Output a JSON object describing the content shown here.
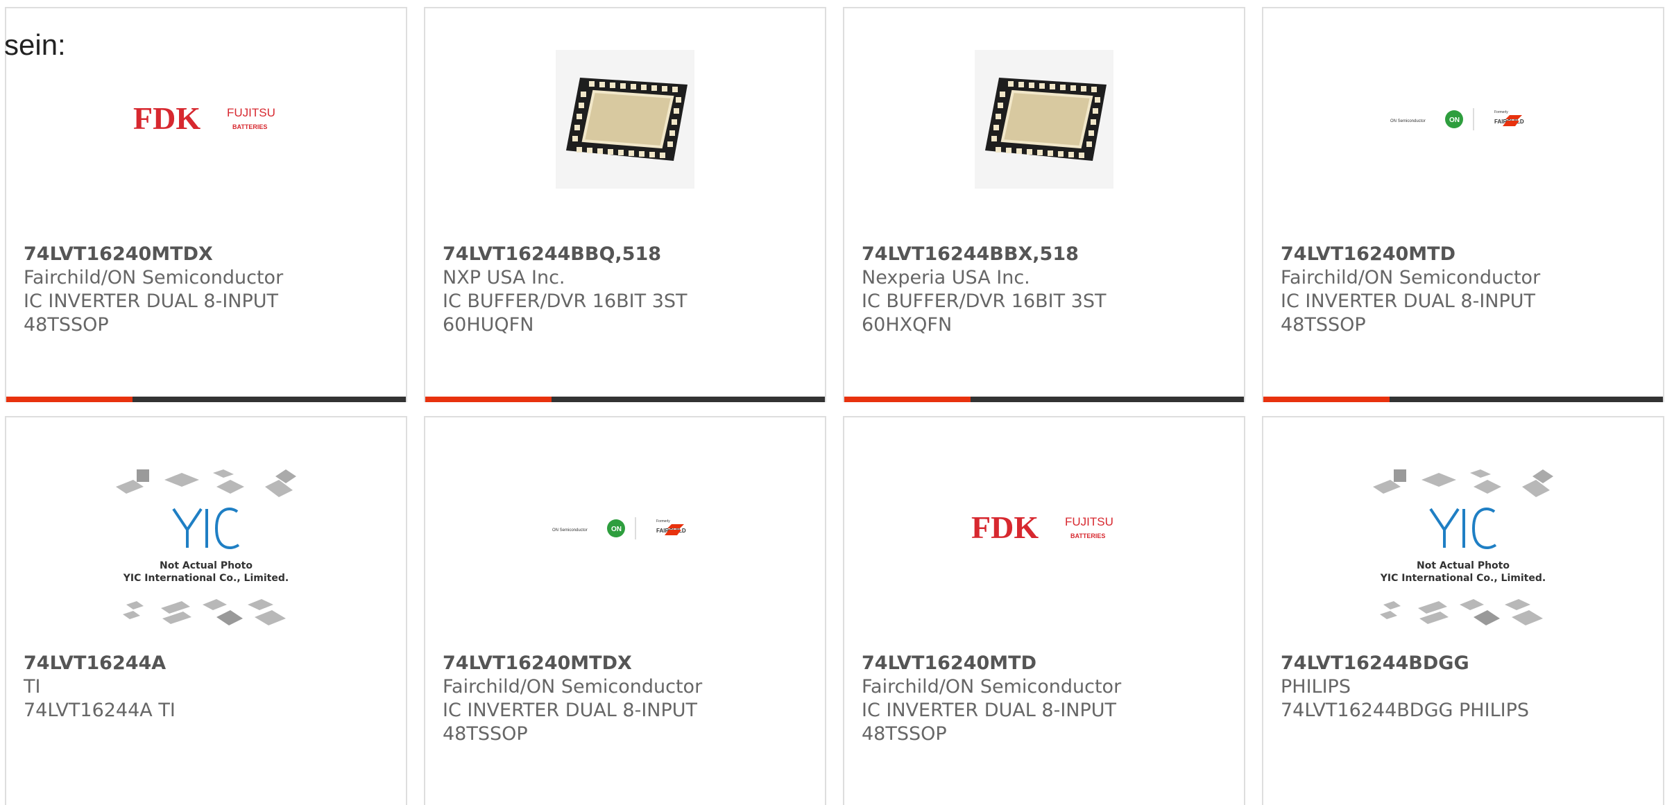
{
  "intro_text": "sein:",
  "products": [
    {
      "part": "74LVT16240MTDX",
      "manufacturer": "Fairchild/ON Semiconductor",
      "desc1": "IC INVERTER DUAL 8-INPUT",
      "desc2": "48TSSOP",
      "image": "fdk-fujitsu-logo"
    },
    {
      "part": "74LVT16244BBQ,518",
      "manufacturer": "NXP USA Inc.",
      "desc1": "IC BUFFER/DVR 16BIT 3ST",
      "desc2": "60HUQFN",
      "image": "qfn-chip-photo"
    },
    {
      "part": "74LVT16244BBX,518",
      "manufacturer": "Nexperia USA Inc.",
      "desc1": "IC BUFFER/DVR 16BIT 3ST",
      "desc2": "60HXQFN",
      "image": "qfn-chip-photo"
    },
    {
      "part": "74LVT16240MTD",
      "manufacturer": "Fairchild/ON Semiconductor",
      "desc1": "IC INVERTER DUAL 8-INPUT",
      "desc2": "48TSSOP",
      "image": "onsemi-fairchild-logo"
    },
    {
      "part": "74LVT16244A",
      "manufacturer": "TI",
      "desc1": "74LVT16244A TI",
      "desc2": "",
      "image": "yic-placeholder"
    },
    {
      "part": "74LVT16240MTDX",
      "manufacturer": "Fairchild/ON Semiconductor",
      "desc1": "IC INVERTER DUAL 8-INPUT",
      "desc2": "48TSSOP",
      "image": "onsemi-fairchild-logo"
    },
    {
      "part": "74LVT16240MTD",
      "manufacturer": "Fairchild/ON Semiconductor",
      "desc1": "IC INVERTER DUAL 8-INPUT",
      "desc2": "48TSSOP",
      "image": "fdk-fujitsu-logo"
    },
    {
      "part": "74LVT16244BDGG",
      "manufacturer": "PHILIPS",
      "desc1": "74LVT16244BDGG PHILIPS",
      "desc2": "",
      "image": "yic-placeholder"
    }
  ],
  "logos": {
    "fdk": "FDK",
    "fujitsu": "FUJITSU",
    "batteries": "BATTERIES",
    "on_semi": "ON Semiconductor",
    "on": "ON",
    "formerly": "Formerly",
    "fairchild": "FAIRCHILD",
    "yic_line1": "Not Actual Photo",
    "yic_line2": "YIC International Co., Limited."
  },
  "colors": {
    "accent": "#e8320e",
    "bar": "#333333",
    "border": "#dedede",
    "fdk_red": "#d7282f",
    "yic_blue": "#1f7fc4"
  }
}
